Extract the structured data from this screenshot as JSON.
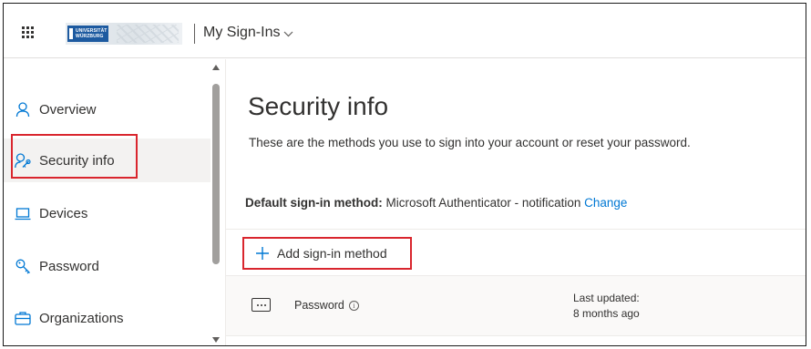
{
  "header": {
    "app_title": "My Sign-Ins",
    "logo_text_line1": "UNIVERSITÄT",
    "logo_text_line2": "WÜRZBURG",
    "waffle_icon": "waffle-grid-icon",
    "chevron_icon": "chevron-down-icon"
  },
  "sidebar": {
    "items": [
      {
        "label": "Overview",
        "icon": "person-icon",
        "active": false
      },
      {
        "label": "Security info",
        "icon": "person-key-icon",
        "active": true
      },
      {
        "label": "Devices",
        "icon": "laptop-icon",
        "active": false
      },
      {
        "label": "Password",
        "icon": "key-icon",
        "active": false
      },
      {
        "label": "Organizations",
        "icon": "briefcase-icon",
        "active": false
      }
    ]
  },
  "main": {
    "title": "Security info",
    "subtitle": "These are the methods you use to sign into your account or reset your password.",
    "default_method_label": "Default sign-in method:",
    "default_method_value": "Microsoft Authenticator - notification",
    "change_link": "Change",
    "add_method_label": "Add sign-in method",
    "methods": [
      {
        "name": "Password",
        "updated_label": "Last updated:",
        "updated_value": "8 months ago",
        "icon": "password-dots-icon"
      }
    ]
  },
  "colors": {
    "accent": "#0078d4",
    "highlight": "#d9262e",
    "active_bg": "#f3f2f1"
  }
}
